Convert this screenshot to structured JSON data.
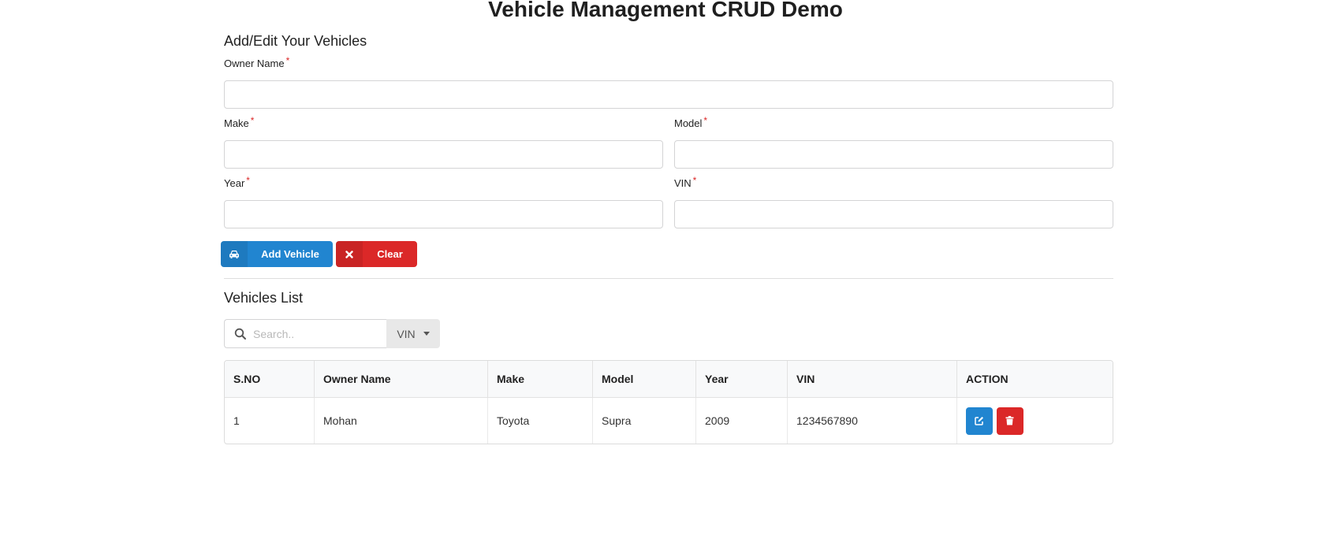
{
  "app": {
    "title": "Vehicle Management CRUD Demo"
  },
  "form": {
    "heading": "Add/Edit Your Vehicles",
    "required_mark": "*",
    "fields": {
      "owner_name": {
        "label": "Owner Name",
        "value": ""
      },
      "make": {
        "label": "Make",
        "value": ""
      },
      "model": {
        "label": "Model",
        "value": ""
      },
      "year": {
        "label": "Year",
        "value": ""
      },
      "vin": {
        "label": "VIN",
        "value": ""
      }
    },
    "buttons": {
      "add": {
        "label": "Add Vehicle",
        "icon": "car-icon",
        "color": "#2185d0"
      },
      "clear": {
        "label": "Clear",
        "icon": "close-icon",
        "color": "#db2828"
      }
    }
  },
  "list": {
    "heading": "Vehicles List",
    "search": {
      "placeholder": "Search..",
      "value": "",
      "filter_selected": "VIN"
    },
    "columns": [
      "S.NO",
      "Owner Name",
      "Make",
      "Model",
      "Year",
      "VIN",
      "ACTION"
    ],
    "rows": [
      {
        "sno": "1",
        "owner": "Mohan",
        "make": "Toyota",
        "model": "Supra",
        "year": "2009",
        "vin": "1234567890"
      }
    ],
    "row_actions": {
      "edit": {
        "icon": "edit-icon",
        "color": "#2185d0"
      },
      "delete": {
        "icon": "trash-icon",
        "color": "#db2828"
      }
    }
  }
}
